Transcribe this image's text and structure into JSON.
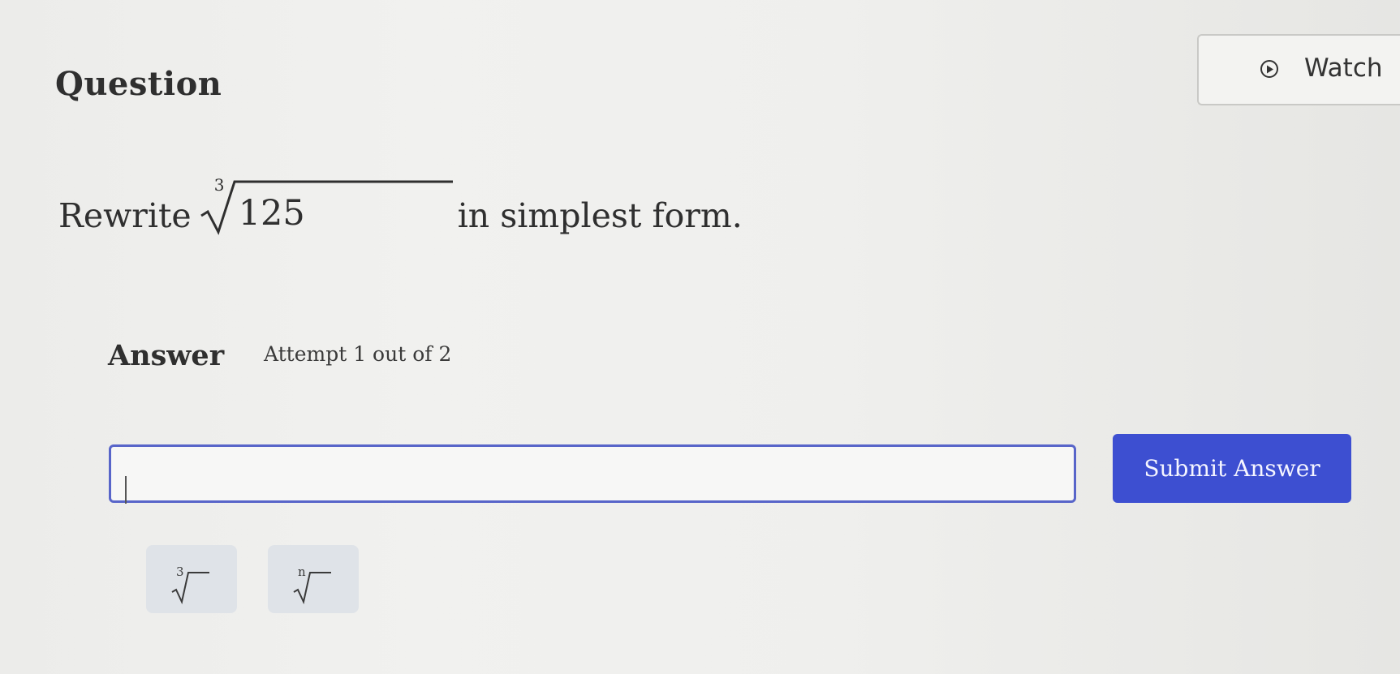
{
  "header": {
    "title": "Question",
    "watch_label": "Watch"
  },
  "question": {
    "prefix": "Rewrite",
    "radical_index": "3",
    "radicand": "125",
    "suffix": "in simplest form."
  },
  "answer": {
    "label": "Answer",
    "attempt": "Attempt 1 out of 2",
    "input_value": "",
    "submit_label": "Submit Answer"
  },
  "math_buttons": [
    {
      "name": "cube-root",
      "index": "3"
    },
    {
      "name": "nth-root",
      "index": "n"
    }
  ],
  "colors": {
    "input_border": "#5865c9",
    "submit_bg": "#3d4fd1",
    "math_button_bg": "#dfe3e8"
  }
}
